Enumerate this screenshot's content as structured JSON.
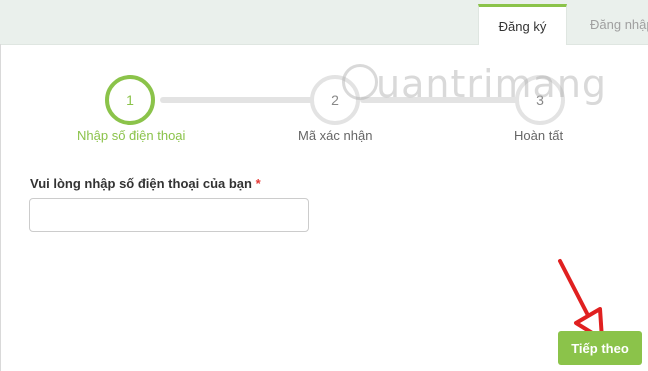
{
  "tabs": {
    "register": "Đăng ký",
    "login": "Đăng nhập"
  },
  "steps": [
    {
      "number": "1",
      "label": "Nhập số điện thoại",
      "state": "active"
    },
    {
      "number": "2",
      "label": "Mã xác nhận",
      "state": "idle"
    },
    {
      "number": "3",
      "label": "Hoàn tất",
      "state": "idle"
    }
  ],
  "watermark": "uantrimang",
  "form": {
    "phone_label": "Vui lòng nhập số điện thoại của bạn",
    "required_mark": "*",
    "phone_value": "",
    "phone_placeholder": ""
  },
  "next_button": "Tiếp theo",
  "colors": {
    "accent": "#8bc34a",
    "required": "#e53935",
    "annotation_arrow": "#e02020"
  }
}
